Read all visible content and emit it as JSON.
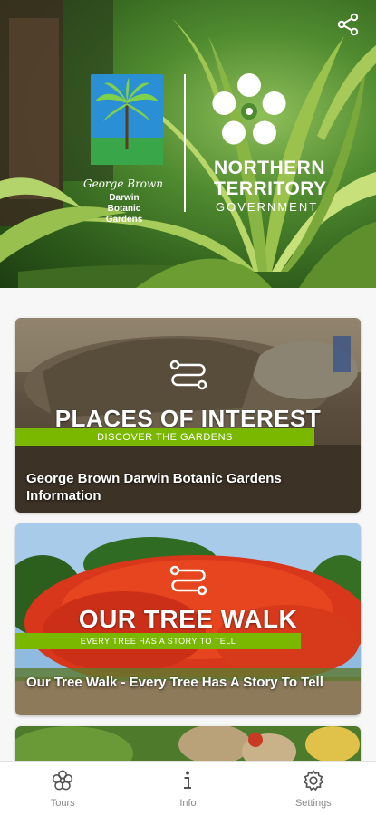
{
  "hero": {
    "share_icon": "share-icon",
    "gb_logo": {
      "script": "George Brown",
      "line1": "Darwin",
      "line2": "Botanic Gardens"
    },
    "nt_logo": {
      "line1": "NORTHERN",
      "line2": "TERRITORY",
      "line3": "GOVERNMENT"
    }
  },
  "cards": [
    {
      "icon": "route-icon",
      "title": "PLACES OF INTEREST",
      "band": "DISCOVER THE GARDENS",
      "caption": "George Brown Darwin Botanic Gardens Information"
    },
    {
      "icon": "route-icon",
      "title": "OUR TREE WALK",
      "band": "EVERY TREE HAS A STORY TO TELL",
      "caption": "Our Tree Walk - Every Tree Has A Story To Tell"
    }
  ],
  "nav": {
    "items": [
      {
        "label": "Tours",
        "icon": "flower-icon"
      },
      {
        "label": "Info",
        "icon": "info-icon"
      },
      {
        "label": "Settings",
        "icon": "gear-icon"
      }
    ]
  },
  "colors": {
    "band_green": "#7ab800",
    "nav_label": "#8a8a8a"
  }
}
